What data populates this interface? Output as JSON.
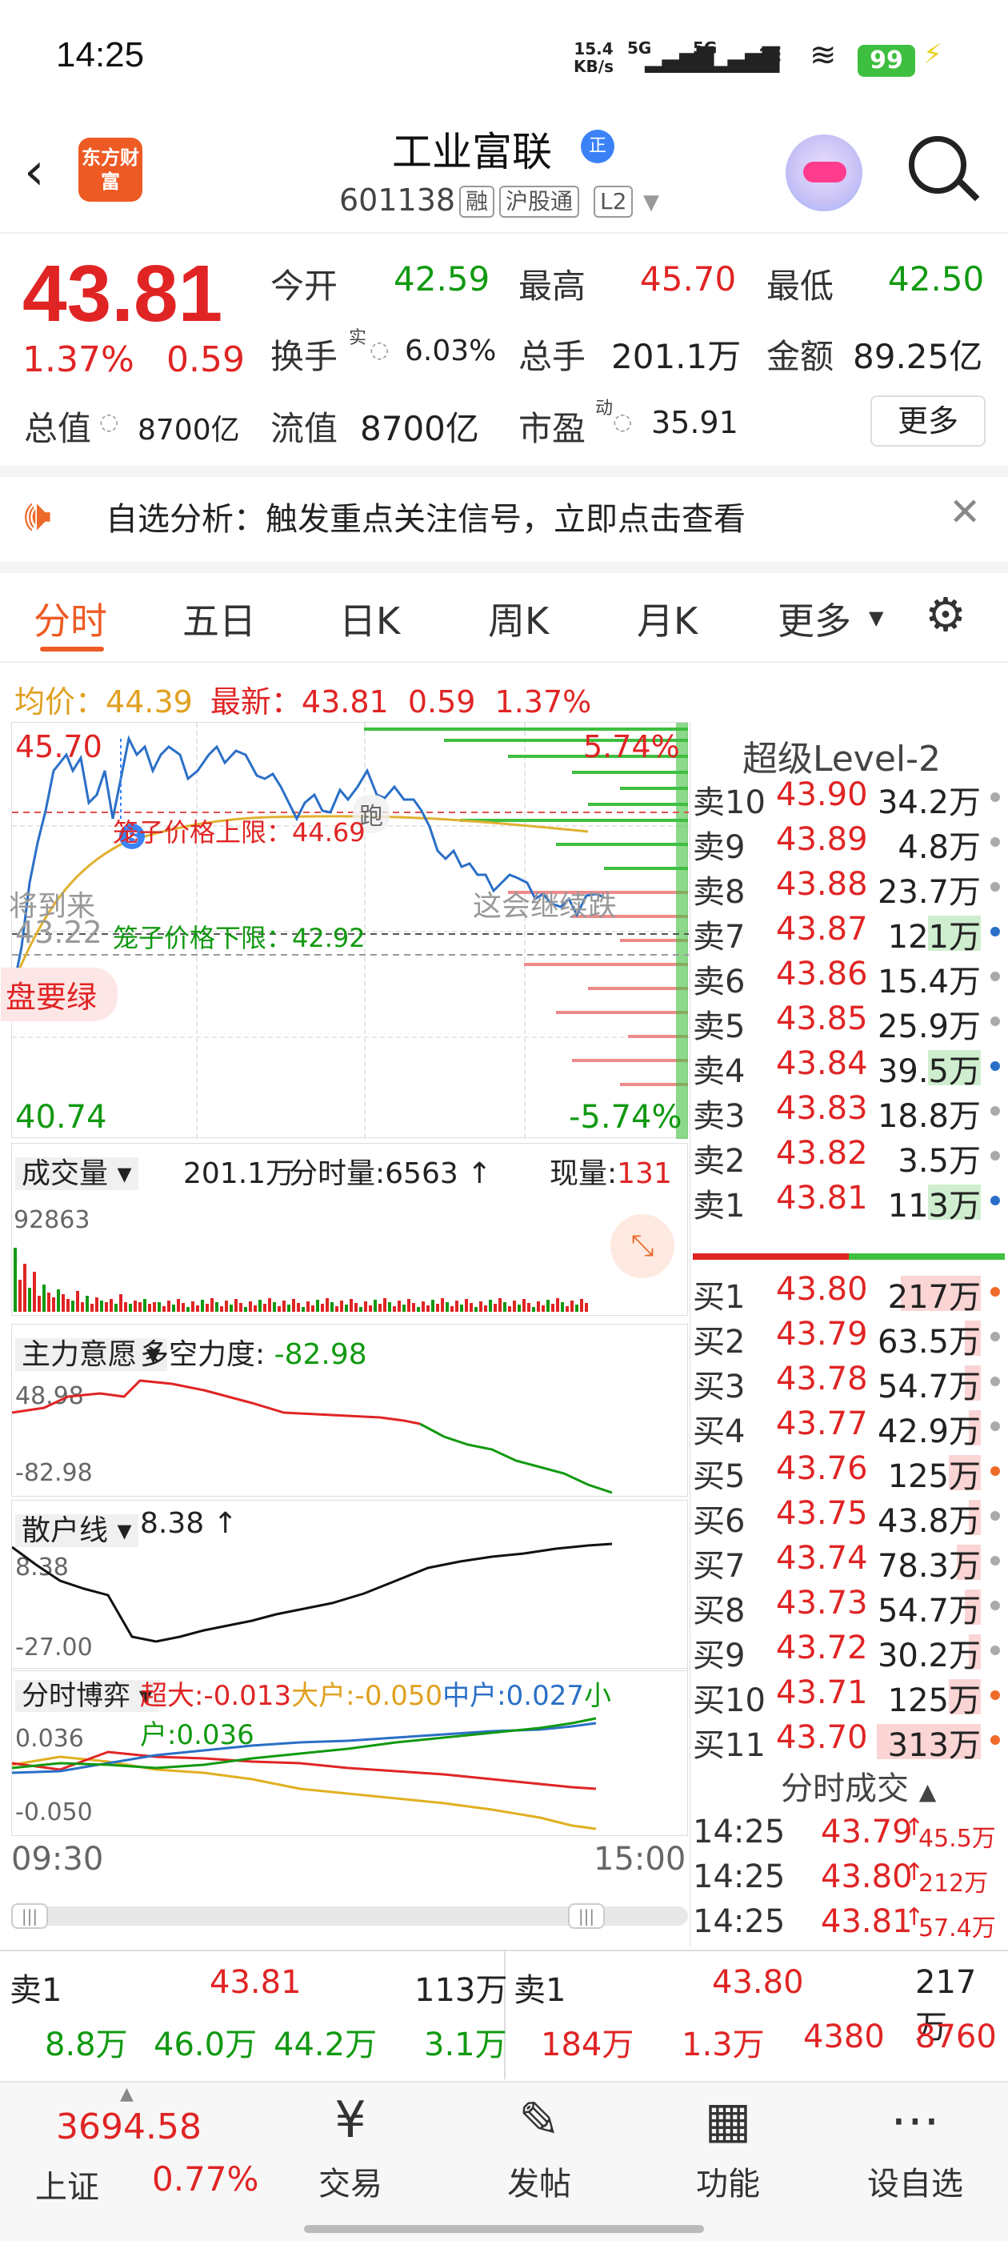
{
  "status_bar": {
    "time": "14:25",
    "net_speed": "15.4 KB/s",
    "signal1": "5G",
    "signal2": "5G",
    "battery": "99"
  },
  "header": {
    "logo": "东方财富",
    "stock_name": "工业富联",
    "stock_tag": "正",
    "code": "601138",
    "badges": [
      "融",
      "沪股通",
      "L2"
    ]
  },
  "quote": {
    "price": "43.81",
    "pct": "1.37%",
    "change": "0.59",
    "open_label": "今开",
    "open": "42.59",
    "high_label": "最高",
    "high": "45.70",
    "low_label": "最低",
    "low": "42.50",
    "turnover_label": "换手",
    "turnover_sup": "实",
    "turnover": "6.03%",
    "volume_label": "总手",
    "volume": "201.1万",
    "amount_label": "金额",
    "amount": "89.25亿",
    "mktcap_label": "总值",
    "mktcap": "8700亿",
    "float_label": "流值",
    "float": "8700亿",
    "pe_label": "市盈",
    "pe_sup": "动",
    "pe": "35.91",
    "more_label": "更多"
  },
  "alert": {
    "text": "自选分析：触发重点关注信号，立即点击查看"
  },
  "tabs": [
    "分时",
    "五日",
    "日K",
    "周K",
    "月K",
    "更多"
  ],
  "info_line": {
    "avg_label": "均价：",
    "avg": "44.39",
    "latest_label": "最新：",
    "latest": "43.81",
    "change": "0.59",
    "pct": "1.37%"
  },
  "chart": {
    "y_high": "45.70",
    "y_low": "40.74",
    "pct_high": "5.74%",
    "pct_low": "-5.74%",
    "mid_price": "43.22",
    "cage_upper": "笼子价格上限：44.69",
    "cage_lower": "笼子价格下限：42.92",
    "annotation_left": "将到来",
    "annotation_right": "这会继续跌",
    "annotation_bottom": "盘要绿",
    "time_start": "09:30",
    "time_end": "15:00",
    "marker_s": "S",
    "marker_run": "跑"
  },
  "volume_panel": {
    "label": "成交量",
    "total": "201.1万",
    "tick_label": "分时量:",
    "tick_value": "6563",
    "now_label": "现量:",
    "now_value": "131",
    "max": "92863"
  },
  "main_force": {
    "label": "主力意愿",
    "metric_label": "多空力度:",
    "metric_value": "-82.98",
    "top": "48.98",
    "bottom": "-82.98"
  },
  "retail_line": {
    "label": "散户线",
    "value": "8.38",
    "top": "8.38",
    "bottom": "-27.00"
  },
  "game_panel": {
    "label": "分时博弈",
    "super_label": "超大:",
    "super": "-0.013",
    "large_label": "大户:",
    "large": "-0.050",
    "mid_label": "中户:",
    "mid": "0.027",
    "small_label": "小户:",
    "small": "0.036",
    "top": "0.036",
    "bottom": "-0.050"
  },
  "l2": {
    "title": "超级Level-2",
    "asks": [
      {
        "label": "卖10",
        "price": "43.90",
        "vol": "34.2万"
      },
      {
        "label": "卖9",
        "price": "43.89",
        "vol": "4.8万"
      },
      {
        "label": "卖8",
        "price": "43.88",
        "vol": "23.7万"
      },
      {
        "label": "卖7",
        "price": "43.87",
        "vol": "121万"
      },
      {
        "label": "卖6",
        "price": "43.86",
        "vol": "15.4万"
      },
      {
        "label": "卖5",
        "price": "43.85",
        "vol": "25.9万"
      },
      {
        "label": "卖4",
        "price": "43.84",
        "vol": "39.5万"
      },
      {
        "label": "卖3",
        "price": "43.83",
        "vol": "18.8万"
      },
      {
        "label": "卖2",
        "price": "43.82",
        "vol": "3.5万"
      },
      {
        "label": "卖1",
        "price": "43.81",
        "vol": "113万"
      }
    ],
    "bids": [
      {
        "label": "买1",
        "price": "43.80",
        "vol": "217万"
      },
      {
        "label": "买2",
        "price": "43.79",
        "vol": "63.5万"
      },
      {
        "label": "买3",
        "price": "43.78",
        "vol": "54.7万"
      },
      {
        "label": "买4",
        "price": "43.77",
        "vol": "42.9万"
      },
      {
        "label": "买5",
        "price": "43.76",
        "vol": "125万"
      },
      {
        "label": "买6",
        "price": "43.75",
        "vol": "43.8万"
      },
      {
        "label": "买7",
        "price": "43.74",
        "vol": "78.3万"
      },
      {
        "label": "买8",
        "price": "43.73",
        "vol": "54.7万"
      },
      {
        "label": "买9",
        "price": "43.72",
        "vol": "30.2万"
      },
      {
        "label": "买10",
        "price": "43.71",
        "vol": "125万"
      },
      {
        "label": "买11",
        "price": "43.70",
        "vol": "313万"
      }
    ]
  },
  "trades": {
    "title": "分时成交",
    "rows": [
      {
        "time": "14:25",
        "price": "43.79",
        "vol": "45.5万"
      },
      {
        "time": "14:25",
        "price": "43.80",
        "vol": "212万"
      },
      {
        "time": "14:25",
        "price": "43.81",
        "vol": "57.4万"
      }
    ]
  },
  "bottom": {
    "sell_label": "卖1",
    "sell_price": "43.81",
    "sell_vol": "113万",
    "buy_label": "卖1",
    "buy_price": "43.80",
    "buy_vol": "217万",
    "sell_queue": [
      "8.8万",
      "46.0万",
      "44.2万",
      "3.1万"
    ],
    "buy_queue": [
      "184万",
      "1.3万",
      "4380",
      "8760"
    ]
  },
  "nav": {
    "index_value": "3694.58",
    "index_name": "上证",
    "index_pct": "0.77%",
    "items": [
      "交易",
      "发帖",
      "功能",
      "设自选"
    ]
  }
}
